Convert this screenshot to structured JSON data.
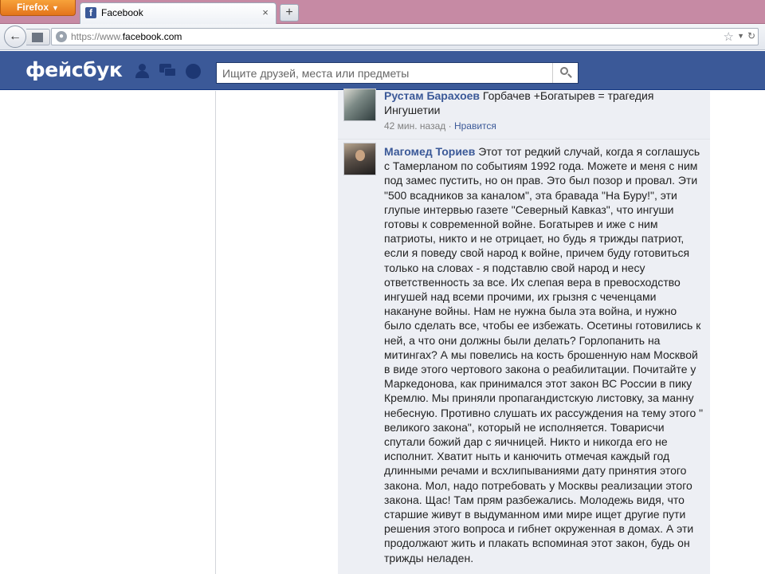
{
  "browser": {
    "menu_button_label": "Firefox",
    "tab_title": "Facebook",
    "tab_close": "×",
    "new_tab": "+",
    "url_scheme": "https://www.",
    "url_domain": "facebook.com"
  },
  "header": {
    "logo": "фейсбук",
    "search_placeholder": "Ищите друзей, места или предметы"
  },
  "comments": [
    {
      "author": "Рустам Барахоев",
      "text": "Горбачев +Богатырев = трагедия Ингушетии",
      "time": "42 мин. назад",
      "separator": " · ",
      "like": "Нравится"
    },
    {
      "author": "Магомед Ториев",
      "text": "Этот тот редкий случай, когда я соглашусь с Тамерланом по событиям 1992 года. Можете и меня с ним под замес пустить, но он прав. Это был позор и провал. Эти \"500 всадников за каналом\", эта бравада \"На Буру!\", эти глупые интервью газете \"Северный Кавказ\", что ингуши готовы к современной войне. Богатырев и иже с ним патриоты, никто и не отрицает, но будь я трижды патриот, если я поведу свой народ к войне, причем буду готовиться только на словах - я подставлю свой народ и несу ответственность за все. Их слепая вера в превосходство ингушей над всеми прочими, их грызня с чеченцами накануне войны. Нам не нужна была эта война, и нужно было сделать все, чтобы ее избежать. Осетины готовились к ней, а что они должны были делать? Горлопанить на митингах? А мы повелись на кость брошенную нам Москвой в виде этого чертового закона о реабилитации. Почитайте у Маркедонова, как принимался этот закон ВС России в пику Кремлю. Мы приняли пропагандистскую листовку, за манну небесную. Противно слушать их рассуждения на тему этого \" великого закона\", который не исполняется. Товарисчи спутали божий дар с яичницей. Никто и никогда его не исполнит. Хватит ныть и канючить отмечая каждый год длинными речами и всхлипываниями дату принятия этого закона. Мол, надо потребовать у Москвы реализации этого закона. Щас! Там прям разбежались. Молодежь видя, что старшие живут в выдуманном ими мире ищет другие пути решения этого вопроса и гибнет окруженная в домах. А эти продолжают жить и плакать вспоминая этот закон, будь он трижды неладен."
    }
  ]
}
